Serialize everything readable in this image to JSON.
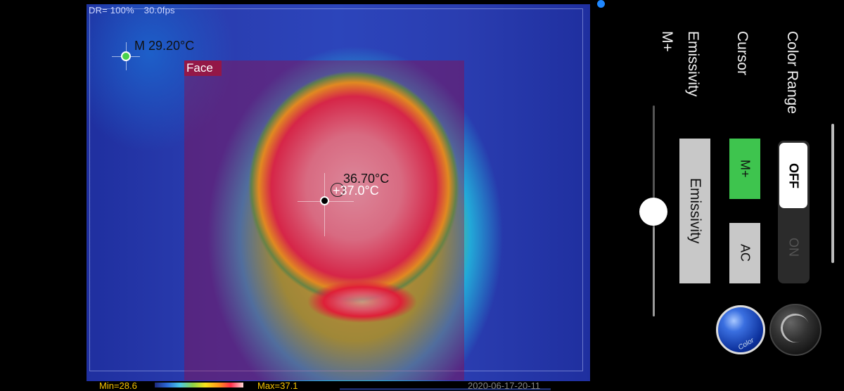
{
  "thermal": {
    "hud_dr": "DR= 100%",
    "hud_fps": "30.0fps",
    "marker_label": "M 29.20°C",
    "region_label": "Face",
    "spot_temp": "36.70°C",
    "max_temp": "+37.0°C"
  },
  "bottom_bar": {
    "min": "Min=28.6",
    "max": "Max=37.1",
    "timestamp": "2020-06-17-20-11"
  },
  "panel": {
    "mplus_title": "M+",
    "emissivity_title": "Emissivity",
    "cursor_title": "Cursor",
    "color_range_title": "Color Range",
    "emissivity_button": "Emissivity",
    "cursor_mplus_button": "M+",
    "cursor_ac_button": "AC",
    "color_range_off": "OFF",
    "color_range_on": "ON",
    "color_ball_label": "Color",
    "slider_level": 0.5
  },
  "colors": {
    "accent_green": "#3ec44e",
    "button_gray": "#c8c8c8",
    "scale_text": "#f7c300"
  }
}
